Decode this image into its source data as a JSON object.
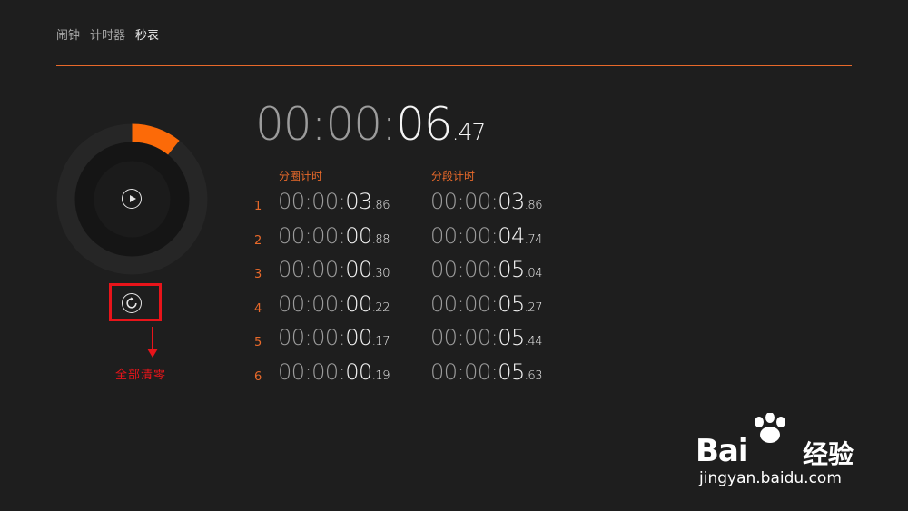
{
  "nav": {
    "tabs": [
      "闹钟",
      "计时器",
      "秒表"
    ],
    "active_index": 2
  },
  "main_time": {
    "hm": "00:00:",
    "sec": "06",
    "frac": ".47"
  },
  "columns": {
    "lap": "分圈计时",
    "split": "分段计时"
  },
  "laps": [
    {
      "num": "1",
      "lap": {
        "hm": "00:00:",
        "sec": "03",
        "frac": ".86"
      },
      "split": {
        "hm": "00:00:",
        "sec": "03",
        "frac": ".86"
      }
    },
    {
      "num": "2",
      "lap": {
        "hm": "00:00:",
        "sec": "00",
        "frac": ".88"
      },
      "split": {
        "hm": "00:00:",
        "sec": "04",
        "frac": ".74"
      }
    },
    {
      "num": "3",
      "lap": {
        "hm": "00:00:",
        "sec": "00",
        "frac": ".30"
      },
      "split": {
        "hm": "00:00:",
        "sec": "05",
        "frac": ".04"
      }
    },
    {
      "num": "4",
      "lap": {
        "hm": "00:00:",
        "sec": "00",
        "frac": ".22"
      },
      "split": {
        "hm": "00:00:",
        "sec": "05",
        "frac": ".27"
      }
    },
    {
      "num": "5",
      "lap": {
        "hm": "00:00:",
        "sec": "00",
        "frac": ".17"
      },
      "split": {
        "hm": "00:00:",
        "sec": "05",
        "frac": ".44"
      }
    },
    {
      "num": "6",
      "lap": {
        "hm": "00:00:",
        "sec": "00",
        "frac": ".19"
      },
      "split": {
        "hm": "00:00:",
        "sec": "05",
        "frac": ".63"
      }
    }
  ],
  "annotation": {
    "label": "全部清零"
  },
  "dial": {
    "progress_fraction": 0.108,
    "play_icon": "play-icon"
  },
  "reset": {
    "icon": "refresh-icon"
  },
  "watermark": {
    "logo": "Bai",
    "logo_cn": "经验",
    "url": "jingyan.baidu.com"
  },
  "colors": {
    "accent": "#e8692a",
    "annotation": "#e8141a",
    "background": "#1e1e1e"
  }
}
